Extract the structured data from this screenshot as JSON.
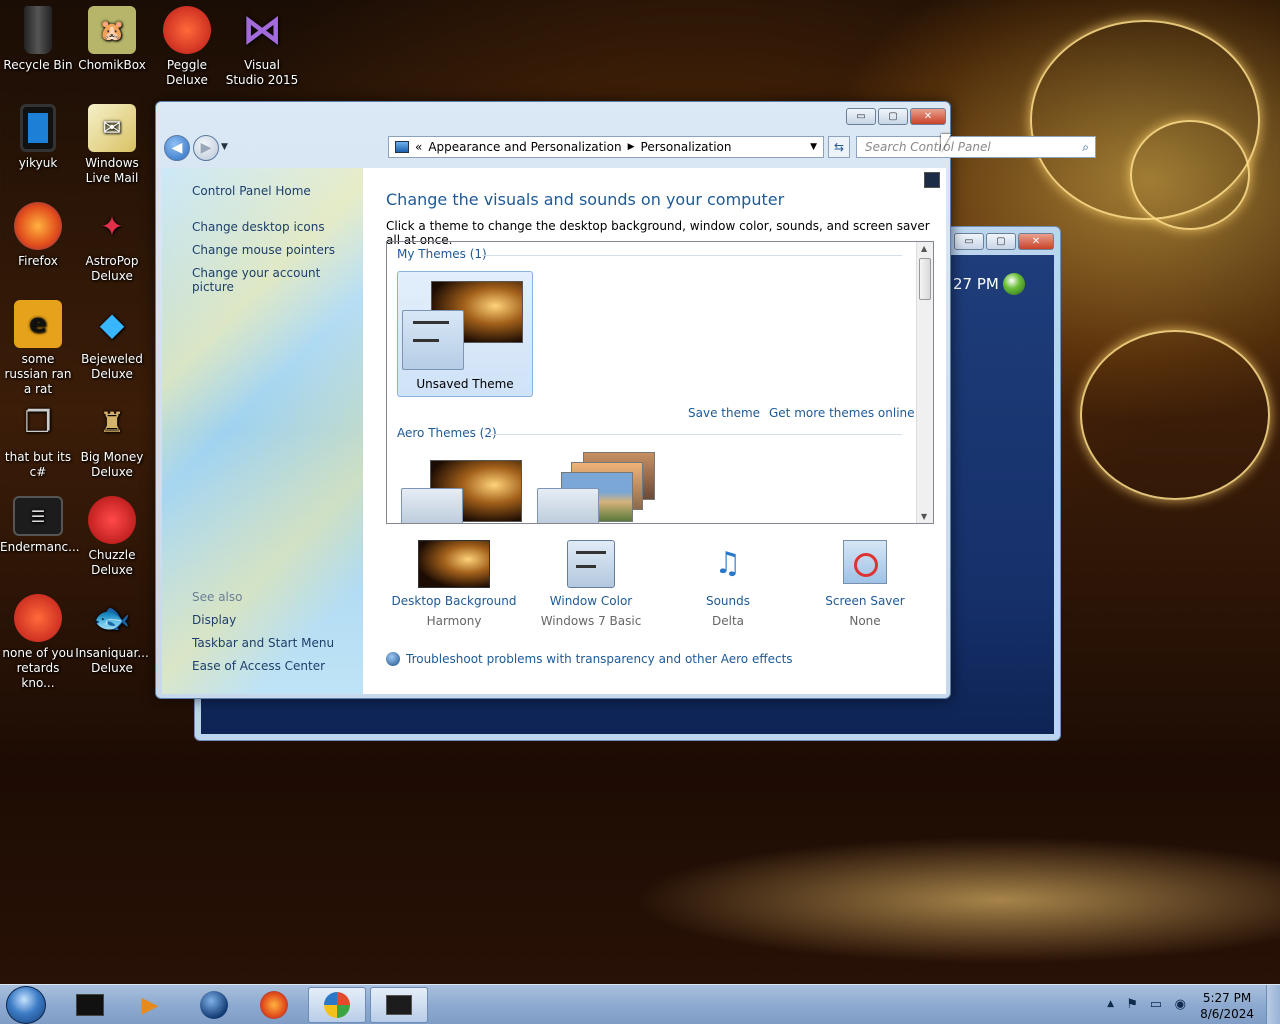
{
  "desktop": {
    "icons": [
      {
        "label": "Recycle Bin",
        "icon": "recycle-bin-icon"
      },
      {
        "label": "ChomikBox",
        "icon": "chomikbox-icon"
      },
      {
        "label": "Peggle Deluxe",
        "icon": "peggle-icon"
      },
      {
        "label": "Visual Studio 2015",
        "icon": "visual-studio-icon"
      },
      {
        "label": "yikyuk",
        "icon": "tablet-icon"
      },
      {
        "label": "Windows Live Mail",
        "icon": "mail-icon"
      },
      {
        "label": "Firefox",
        "icon": "firefox-icon"
      },
      {
        "label": "AstroPop Deluxe",
        "icon": "astropop-icon"
      },
      {
        "label": "some russian ran a rat",
        "icon": "rat-icon"
      },
      {
        "label": "Bejeweled Deluxe",
        "icon": "bejeweled-icon"
      },
      {
        "label": "that but its c#",
        "icon": "windows-copy-icon"
      },
      {
        "label": "Big Money Deluxe",
        "icon": "big-money-icon"
      },
      {
        "label": "Endermanc...",
        "icon": "window-dark-icon"
      },
      {
        "label": "Chuzzle Deluxe",
        "icon": "chuzzle-icon"
      },
      {
        "label": "none of you retards kno...",
        "icon": "none-of-you-icon"
      },
      {
        "label": "Insaniquar... Deluxe",
        "icon": "insaniquarium-icon"
      }
    ]
  },
  "back_window": {
    "clock_text": "27 PM"
  },
  "window": {
    "minimize": "▭",
    "maximize": "▢",
    "close": "✕",
    "breadcrumb": [
      "Appearance and Personalization",
      "Personalization"
    ],
    "breadcrumb_prefix": "«",
    "search_placeholder": "Search Control Panel",
    "left_pane": {
      "home": "Control Panel Home",
      "tasks": [
        "Change desktop icons",
        "Change mouse pointers",
        "Change your account picture"
      ],
      "see_also_heading": "See also",
      "see_also": [
        "Display",
        "Taskbar and Start Menu",
        "Ease of Access Center"
      ]
    },
    "title": "Change the visuals and sounds on your computer",
    "subtitle": "Click a theme to change the desktop background, window color, sounds, and screen saver all at once.",
    "my_themes_label": "My Themes (1)",
    "unsaved_theme_label": "Unsaved Theme",
    "save_theme": "Save theme",
    "get_more_themes": "Get more themes online",
    "aero_themes_label": "Aero Themes (2)",
    "bottom_items": [
      {
        "label": "Desktop Background",
        "value": "Harmony",
        "icon": "desktop-background-icon"
      },
      {
        "label": "Window Color",
        "value": "Windows 7 Basic",
        "icon": "window-color-icon"
      },
      {
        "label": "Sounds",
        "value": "Delta",
        "icon": "sounds-icon"
      },
      {
        "label": "Screen Saver",
        "value": "None",
        "icon": "screen-saver-icon"
      }
    ],
    "troubleshoot": "Troubleshoot problems with transparency and other Aero effects"
  },
  "taskbar": {
    "time": "5:27 PM",
    "date": "8/6/2024"
  },
  "colors": {
    "link": "#1e5a96",
    "taskbar": "#8eaad0"
  }
}
